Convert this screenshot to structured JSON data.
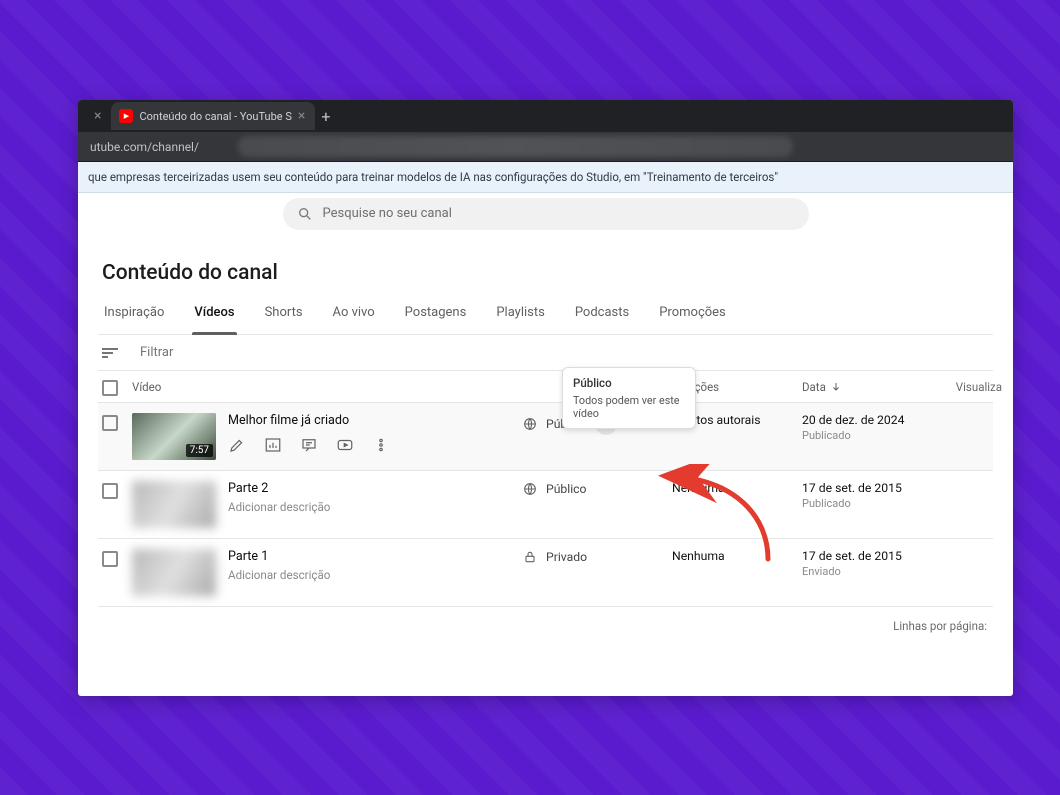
{
  "browser": {
    "tabs": [
      {
        "title": "",
        "active": false
      },
      {
        "title": "Conteúdo do canal - YouTube S",
        "active": true
      }
    ],
    "new_tab_glyph": "+",
    "url_prefix": "utube.com/channel/"
  },
  "banner": {
    "text": "que empresas terceirizadas usem seu conteúdo para treinar modelos de IA nas configurações do Studio, em \"Treinamento de terceiros\""
  },
  "search": {
    "placeholder": "Pesquise no seu canal"
  },
  "page_title": "Conteúdo do canal",
  "tabs": [
    {
      "label": "Inspiração",
      "active": false
    },
    {
      "label": "Vídeos",
      "active": true
    },
    {
      "label": "Shorts",
      "active": false
    },
    {
      "label": "Ao vivo",
      "active": false
    },
    {
      "label": "Postagens",
      "active": false
    },
    {
      "label": "Playlists",
      "active": false
    },
    {
      "label": "Podcasts",
      "active": false
    },
    {
      "label": "Promoções",
      "active": false
    }
  ],
  "filter_label": "Filtrar",
  "columns": {
    "video": "Vídeo",
    "restrictions": "estrições",
    "date": "Data",
    "views": "Visualiza"
  },
  "tooltip": {
    "title": "Público",
    "sub": "Todos podem ver este vídeo"
  },
  "rows": [
    {
      "title": "Melhor filme já criado",
      "subtitle": "",
      "duration": "7:57",
      "visibility": "Público",
      "visibility_icon": "globe",
      "restrictions": "Direitos autorais",
      "date": "20 de dez. de 2024",
      "date_sub": "Publicado",
      "hover": true,
      "show_actions": true,
      "show_caret": true
    },
    {
      "title": "Parte 2",
      "subtitle": "Adicionar descrição",
      "duration": "",
      "visibility": "Público",
      "visibility_icon": "globe",
      "restrictions": "Nenhuma",
      "date": "17 de set. de 2015",
      "date_sub": "Publicado",
      "hover": false,
      "show_actions": false,
      "show_caret": false
    },
    {
      "title": "Parte 1",
      "subtitle": "Adicionar descrição",
      "duration": "",
      "visibility": "Privado",
      "visibility_icon": "lock",
      "restrictions": "Nenhuma",
      "date": "17 de set. de 2015",
      "date_sub": "Enviado",
      "hover": false,
      "show_actions": false,
      "show_caret": false
    }
  ],
  "footer": {
    "rows_per_page": "Linhas por página:"
  }
}
